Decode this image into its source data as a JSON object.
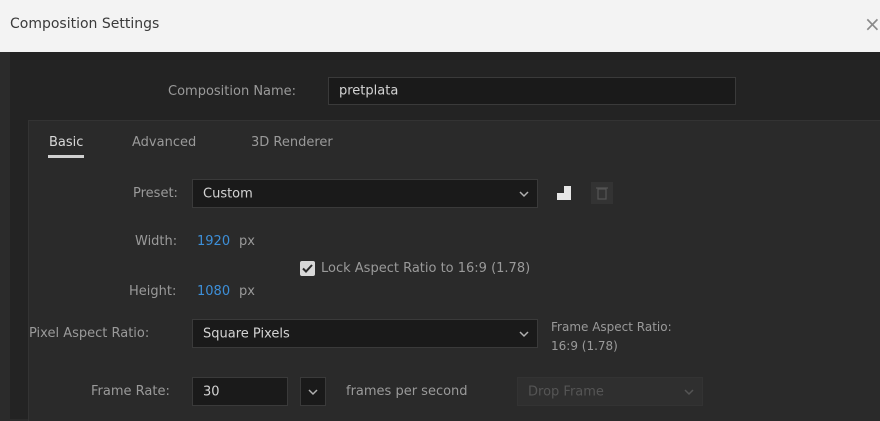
{
  "window": {
    "title": "Composition Settings",
    "close_glyph": "×"
  },
  "comp_name": {
    "label": "Composition Name:",
    "value": "pretplata"
  },
  "tabs": [
    {
      "label": "Basic",
      "active": true
    },
    {
      "label": "Advanced",
      "active": false
    },
    {
      "label": "3D Renderer",
      "active": false
    }
  ],
  "preset": {
    "label": "Preset:",
    "value": "Custom",
    "icons": [
      "save-preset-icon",
      "delete-preset-icon"
    ]
  },
  "width": {
    "label": "Width:",
    "value": "1920",
    "unit": "px"
  },
  "height": {
    "label": "Height:",
    "value": "1080",
    "unit": "px"
  },
  "lock_aspect": {
    "label": "Lock Aspect Ratio to 16:9 (1.78)",
    "checked": true
  },
  "pixel_aspect": {
    "label": "Pixel Aspect Ratio:",
    "value": "Square Pixels"
  },
  "frame_aspect": {
    "label": "Frame Aspect Ratio:",
    "value": "16:9 (1.78)"
  },
  "frame_rate": {
    "label": "Frame Rate:",
    "value": "30",
    "unit": "frames per second",
    "drop_frame": "Drop Frame"
  },
  "colors": {
    "accent_blue": "#3d8fd8",
    "bg": "#232323",
    "titlebar": "#f3f3f3"
  }
}
